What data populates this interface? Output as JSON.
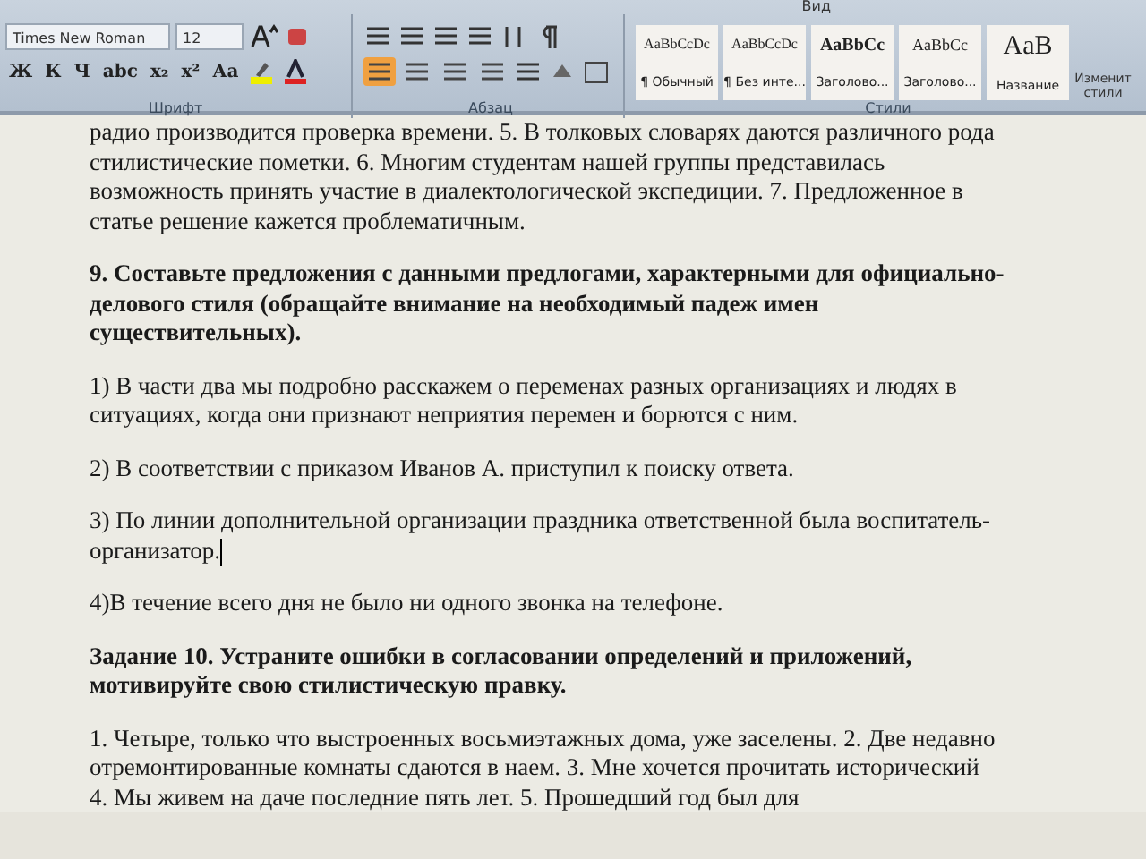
{
  "ribbon": {
    "tabs": [
      {
        "label": "Вид",
        "selected": false
      }
    ],
    "font_group": {
      "label": "Шрифт",
      "font_name": "Times New Roman",
      "font_size": "12",
      "format_buttons": [
        "Ж",
        "К",
        "Ч",
        "abc",
        "x₂",
        "x²",
        "Аа"
      ]
    },
    "paragraph_group": {
      "label": "Абзац",
      "alignments": [
        {
          "selected": true
        },
        {
          "selected": false
        },
        {
          "selected": false
        },
        {
          "selected": false
        }
      ]
    },
    "styles_group": {
      "label": "Стили",
      "styles": [
        {
          "preview": "AaBbCcDc",
          "name": "¶ Обычный",
          "kind": "normal"
        },
        {
          "preview": "AaBbCcDc",
          "name": "¶ Без инте...",
          "kind": "normal"
        },
        {
          "preview": "AaBbCc",
          "name": "Заголово...",
          "kind": "heading1"
        },
        {
          "preview": "AaBbCc",
          "name": "Заголово...",
          "kind": "heading2"
        },
        {
          "preview": "AaB",
          "name": "Название",
          "kind": "title"
        }
      ],
      "change_styles": "Изменит стили"
    }
  },
  "document": {
    "paragraphs": [
      {
        "kind": "text",
        "lines": [
          "радио производится  проверка времени. 5. В толковых словарях даются различного рода",
          "стилистические  пометки. 6. Многим студентам нашей группы представилась",
          "возможность принять участие в диалектологической экспедиции. 7. Предложенное в",
          "статье решение кажется проблематичным."
        ]
      },
      {
        "kind": "bold",
        "lines": [
          "9. Составьте предложения с данными предлогами, характерными для официально-",
          "делового стиля (обращайте внимание на необходимый падеж имен",
          "существительных)."
        ]
      },
      {
        "kind": "text",
        "lines": [
          "1) В части два мы подробно расскажем о переменах разных организациях и людях в",
          "ситуациях, когда они признают неприятия перемен и борются с ним."
        ]
      },
      {
        "kind": "text",
        "lines": [
          "2) В соответствии с приказом Иванов А. приступил к поиску ответа."
        ]
      },
      {
        "kind": "text",
        "cursor": true,
        "lines": [
          "3) По линии дополнительной организации праздника ответственной была воспитатель-",
          "организатор."
        ]
      },
      {
        "kind": "text",
        "lines": [
          "4)В течение всего дня не было ни одного звонка на телефоне."
        ]
      },
      {
        "kind": "bold",
        "lines": [
          "Задание 10. Устраните  ошибки в  согласовании определений и приложений,",
          "мотивируйте  свою стилистическую правку."
        ]
      },
      {
        "kind": "text",
        "lines": [
          "1. Четыре, только что выстроенных восьмиэтажных дома, уже заселены.  2. Две недавно",
          "отремонтированные комнаты сдаются в наем.  3. Мне хочется прочитать исторический",
          "4. Мы живем на даче последние пять лет. 5. Прошедший год был для"
        ]
      }
    ]
  }
}
